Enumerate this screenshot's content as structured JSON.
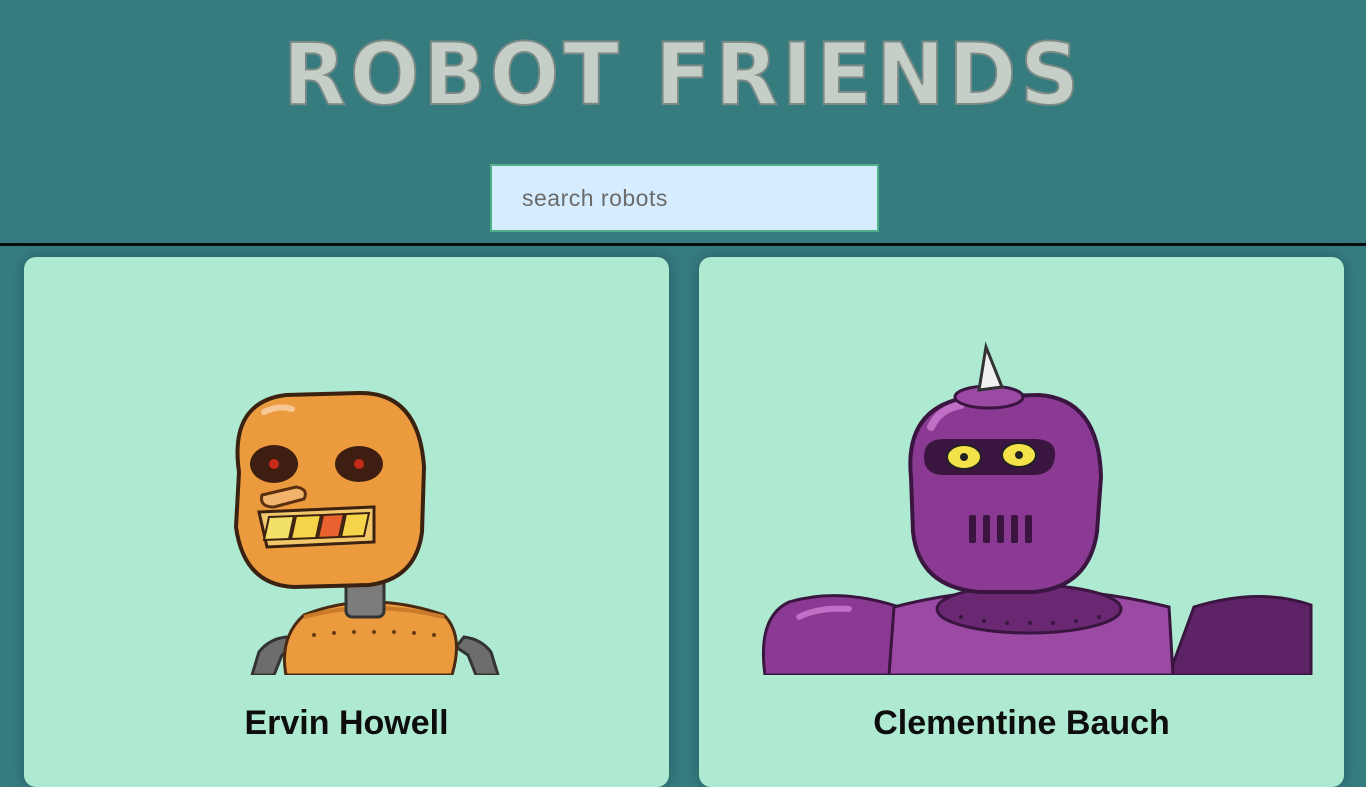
{
  "header": {
    "title": "ROBOT FRIENDS",
    "title_color": "#c5cfc8",
    "title_outline": "#7a8a86"
  },
  "search": {
    "placeholder": "search robots",
    "value": ""
  },
  "colors": {
    "background": "#367c7f",
    "card": "#aee9d2",
    "search_bg": "#d6ecff"
  },
  "robots": [
    {
      "name": "Ervin Howell",
      "avatar_icon": "orange-robot-icon"
    },
    {
      "name": "Clementine Bauch",
      "avatar_icon": "purple-robot-icon"
    }
  ]
}
